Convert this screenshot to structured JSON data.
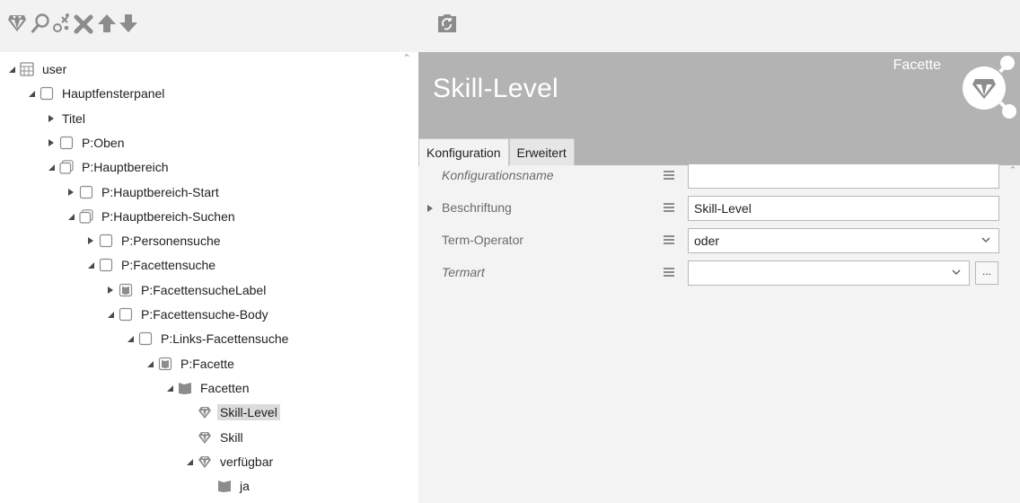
{
  "toolbar": {
    "icons": [
      "facet-gem-icon",
      "search-icon",
      "gender-icon",
      "delete-icon",
      "move-up-icon",
      "move-down-icon"
    ],
    "secondary_icon": "refresh-icon"
  },
  "tree": {
    "items": [
      {
        "label": "user",
        "expanded": "open",
        "icon": "grid-icon",
        "selected": false
      },
      {
        "label": "Hauptfensterpanel",
        "expanded": "open",
        "icon": "panel-icon",
        "selected": false
      },
      {
        "label": "Titel",
        "expanded": "closed",
        "icon": "none",
        "selected": false
      },
      {
        "label": "P:Oben",
        "expanded": "closed",
        "icon": "panel-icon",
        "selected": false
      },
      {
        "label": "P:Hauptbereich",
        "expanded": "open",
        "icon": "panel-stack-icon",
        "selected": false
      },
      {
        "label": "P:Hauptbereich-Start",
        "expanded": "closed",
        "icon": "panel-icon",
        "selected": false
      },
      {
        "label": "P:Hauptbereich-Suchen",
        "expanded": "open",
        "icon": "panel-stack-icon",
        "selected": false
      },
      {
        "label": "P:Personensuche",
        "expanded": "closed",
        "icon": "panel-icon",
        "selected": false
      },
      {
        "label": "P:Facettensuche",
        "expanded": "open",
        "icon": "panel-icon",
        "selected": false
      },
      {
        "label": "P:FacettensucheLabel",
        "expanded": "closed",
        "icon": "panel-filled-icon",
        "selected": false
      },
      {
        "label": "P:Facettensuche-Body",
        "expanded": "open",
        "icon": "panel-icon",
        "selected": false
      },
      {
        "label": "P:Links-Facettensuche",
        "expanded": "open",
        "icon": "panel-icon",
        "selected": false
      },
      {
        "label": "P:Facette",
        "expanded": "open",
        "icon": "panel-filled-icon",
        "selected": false
      },
      {
        "label": "Facetten",
        "expanded": "open",
        "icon": "folder-icon",
        "selected": false
      },
      {
        "label": "Skill-Level",
        "expanded": "none",
        "icon": "gem-icon",
        "selected": true
      },
      {
        "label": "Skill",
        "expanded": "none",
        "icon": "gem-icon",
        "selected": false
      },
      {
        "label": "verfügbar",
        "expanded": "open",
        "icon": "gem-icon",
        "selected": false
      },
      {
        "label": "ja",
        "expanded": "none",
        "icon": "folder-icon",
        "selected": false
      }
    ]
  },
  "detail": {
    "title": "Skill-Level",
    "type_label": "Facette",
    "type_icon": "facet-share-icon",
    "tabs": [
      {
        "label": "Konfiguration",
        "active": true
      },
      {
        "label": "Erweitert",
        "active": false
      }
    ],
    "fields": [
      {
        "label": "Konfigurationsname",
        "italic": true,
        "expandable": false,
        "value": "",
        "kind": "text"
      },
      {
        "label": "Beschriftung",
        "italic": false,
        "expandable": true,
        "value": "Skill-Level",
        "kind": "text"
      },
      {
        "label": "Term-Operator",
        "italic": false,
        "expandable": false,
        "value": "oder",
        "kind": "select"
      },
      {
        "label": "Termart",
        "italic": true,
        "expandable": false,
        "value": "",
        "kind": "select-ellipsis"
      }
    ],
    "ellipsis_label": "..."
  },
  "colors": {
    "header_bg": "#b3b3b3",
    "toolbar_bg": "#f2f2f2",
    "panel_bg": "#f3f3f3",
    "selection_bg": "#dcdcdc",
    "icon_gray": "#8c8c8c"
  }
}
